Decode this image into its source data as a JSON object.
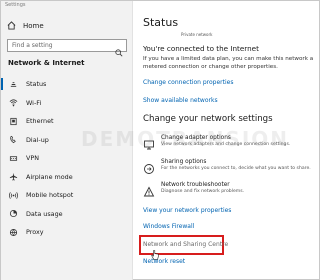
{
  "window": {
    "title": "Settings"
  },
  "sidebar": {
    "home_label": "Home",
    "search_placeholder": "Find a setting",
    "section_title": "Network & Internet",
    "items": [
      {
        "label": "Status",
        "icon": "status-icon",
        "active": true
      },
      {
        "label": "Wi-Fi",
        "icon": "wifi-icon"
      },
      {
        "label": "Ethernet",
        "icon": "ethernet-icon"
      },
      {
        "label": "Dial-up",
        "icon": "dialup-icon"
      },
      {
        "label": "VPN",
        "icon": "vpn-icon"
      },
      {
        "label": "Airplane mode",
        "icon": "airplane-icon"
      },
      {
        "label": "Mobile hotspot",
        "icon": "hotspot-icon"
      },
      {
        "label": "Data usage",
        "icon": "data-usage-icon"
      },
      {
        "label": "Proxy",
        "icon": "proxy-icon"
      }
    ]
  },
  "main": {
    "title": "Status",
    "network_name": "Private network",
    "connected_heading": "You're connected to the Internet",
    "connected_text": "If you have a limited data plan, you can make this network a metered connection or change other properties.",
    "change_connection_link": "Change connection properties",
    "show_networks_link": "Show available networks",
    "change_settings_heading": "Change your network settings",
    "options": [
      {
        "title": "Change adapter options",
        "desc": "View network adapters and change connection settings.",
        "icon": "adapter-icon"
      },
      {
        "title": "Sharing options",
        "desc": "For the networks you connect to, decide what you want to share.",
        "icon": "sharing-icon"
      },
      {
        "title": "Network troubleshooter",
        "desc": "Diagnose and fix network problems.",
        "icon": "troubleshooter-icon"
      }
    ],
    "view_properties_link": "View your network properties",
    "firewall_link": "Windows Firewall",
    "sharing_center_link": "Network and Sharing Centre",
    "reset_link": "Network reset"
  },
  "watermark": "DEMOTRANSION",
  "colors": {
    "accent": "#0063b1",
    "highlight": "#d71d1d",
    "sidebar_bg": "#f2f2f2"
  }
}
